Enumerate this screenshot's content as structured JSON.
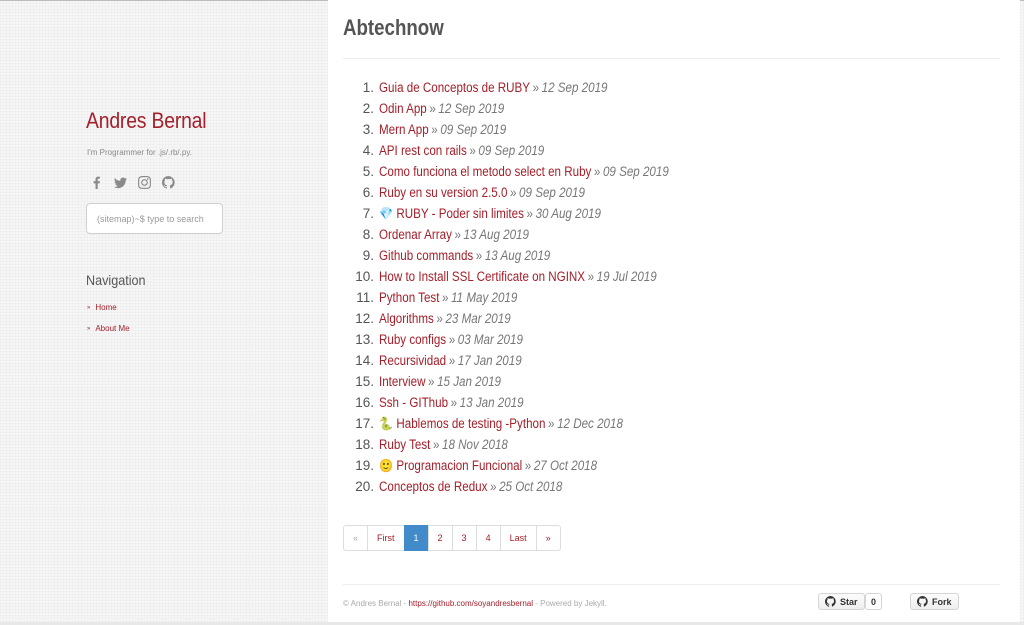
{
  "sidebar": {
    "title": "Andres Bernal",
    "tagline": "I'm Programmer for .js/.rb/.py.",
    "social_icons": [
      "facebook-icon",
      "twitter-icon",
      "instagram-icon",
      "github-icon"
    ],
    "search_placeholder": "(sitemap)~$ type to search",
    "nav_heading": "Navigation",
    "nav_items": [
      {
        "label": "Home"
      },
      {
        "label": "About Me"
      }
    ]
  },
  "main": {
    "title": "Abtechnow",
    "separator": "»",
    "posts": [
      {
        "num": "1.",
        "emoji": "",
        "title": "Guia de Conceptos de RUBY",
        "date": "12 Sep 2019"
      },
      {
        "num": "2.",
        "emoji": "",
        "title": "Odin App",
        "date": "12 Sep 2019"
      },
      {
        "num": "3.",
        "emoji": "",
        "title": "Mern App",
        "date": "09 Sep 2019"
      },
      {
        "num": "4.",
        "emoji": "",
        "title": "API rest con rails",
        "date": "09 Sep 2019"
      },
      {
        "num": "5.",
        "emoji": "",
        "title": "Como funciona el metodo select en Ruby",
        "date": "09 Sep 2019"
      },
      {
        "num": "6.",
        "emoji": "",
        "title": "Ruby en su version 2.5.0",
        "date": "09 Sep 2019"
      },
      {
        "num": "7.",
        "emoji": "💎",
        "title": "RUBY - Poder sin limites",
        "date": "30 Aug 2019"
      },
      {
        "num": "8.",
        "emoji": "",
        "title": "Ordenar Array",
        "date": "13 Aug 2019"
      },
      {
        "num": "9.",
        "emoji": "",
        "title": "Github commands",
        "date": "13 Aug 2019"
      },
      {
        "num": "10.",
        "emoji": "",
        "title": "How to Install SSL Certificate on NGINX",
        "date": "19 Jul 2019"
      },
      {
        "num": "11.",
        "emoji": "",
        "title": "Python Test",
        "date": "11 May 2019"
      },
      {
        "num": "12.",
        "emoji": "",
        "title": "Algorithms",
        "date": "23 Mar 2019"
      },
      {
        "num": "13.",
        "emoji": "",
        "title": "Ruby configs",
        "date": "03 Mar 2019"
      },
      {
        "num": "14.",
        "emoji": "",
        "title": "Recursividad",
        "date": "17 Jan 2019"
      },
      {
        "num": "15.",
        "emoji": "",
        "title": "Interview",
        "date": "15 Jan 2019"
      },
      {
        "num": "16.",
        "emoji": "",
        "title": "Ssh - GIThub",
        "date": "13 Jan 2019"
      },
      {
        "num": "17.",
        "emoji": "🐍",
        "title": "Hablemos de testing -Python",
        "date": "12 Dec 2018"
      },
      {
        "num": "18.",
        "emoji": "",
        "title": "Ruby Test",
        "date": "18 Nov 2018"
      },
      {
        "num": "19.",
        "emoji": "🙂",
        "title": "Programacion Funcional",
        "date": "27 Oct 2018"
      },
      {
        "num": "20.",
        "emoji": "",
        "title": "Conceptos de Redux",
        "date": "25 Oct 2018"
      }
    ],
    "pagination": [
      {
        "label": "«",
        "state": "disabled"
      },
      {
        "label": "First",
        "state": "normal"
      },
      {
        "label": "1",
        "state": "active"
      },
      {
        "label": "2",
        "state": "normal"
      },
      {
        "label": "3",
        "state": "normal"
      },
      {
        "label": "4",
        "state": "normal"
      },
      {
        "label": "Last",
        "state": "normal"
      },
      {
        "label": "»",
        "state": "normal"
      }
    ],
    "footer": {
      "prefix": "© Andres Bernal - ",
      "link": "https://github.com/soyandresbernal",
      "suffix": " - Powered by Jekyll."
    },
    "github_buttons": {
      "star_label": "Star",
      "star_count": "0",
      "fork_label": "Fork"
    }
  },
  "colors": {
    "accent": "#a4202b",
    "active_page": "#428bca"
  }
}
